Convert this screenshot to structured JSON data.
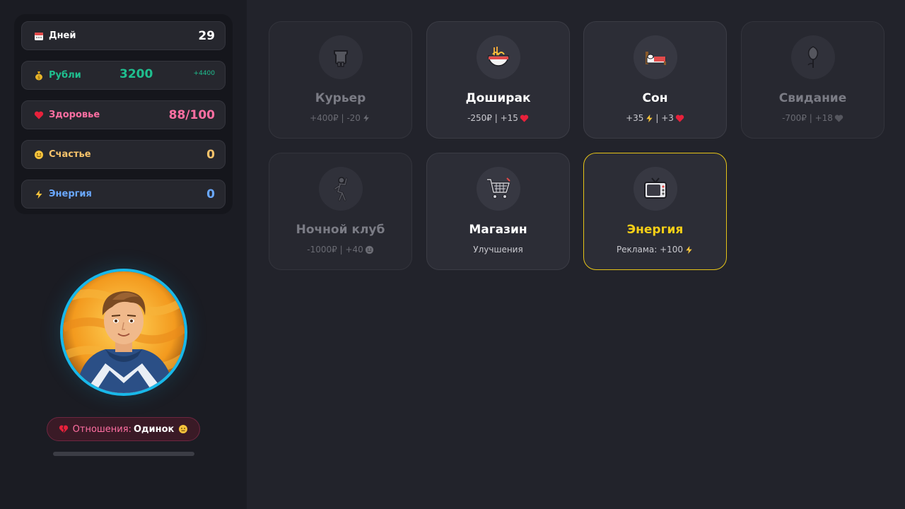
{
  "stats": {
    "days": {
      "label": "Дней",
      "value": "29",
      "color": "#ffffff",
      "icon": "calendar-icon"
    },
    "money": {
      "label": "Рубли",
      "value": "3200",
      "delta": "+4400",
      "color": "#1fbf8f",
      "icon": "money-bag-icon"
    },
    "health": {
      "label": "Здоровье",
      "value": "88/100",
      "color": "#ff6fa2",
      "icon": "heart-icon"
    },
    "happiness": {
      "label": "Счастье",
      "value": "0",
      "color": "#f7c36b",
      "icon": "smile-icon"
    },
    "energy": {
      "label": "Энергия",
      "value": "0",
      "color": "#6aa8ff",
      "icon": "lightning-icon"
    }
  },
  "relationship": {
    "label": "Отношения:",
    "value": "Одинок",
    "progress": 0
  },
  "actions": [
    {
      "title": "Курьер",
      "sub": "+400₽ | -20",
      "sub_icon": "lightning-icon",
      "icon": "courier-icon",
      "state": "disabled"
    },
    {
      "title": "Доширак",
      "sub": "-250₽ | +15",
      "sub_icon": "heart-icon",
      "icon": "noodles-icon",
      "state": "enabled"
    },
    {
      "title": "Сон",
      "sub_a": "+35",
      "sub_b": "| +3",
      "icon": "bed-icon",
      "state": "enabled"
    },
    {
      "title": "Свидание",
      "sub": "-700₽ | +18",
      "sub_icon": "heart-icon",
      "icon": "rose-icon",
      "state": "disabled"
    },
    {
      "title": "Ночной клуб",
      "sub": "-1000₽ | +40",
      "sub_icon": "smile-icon",
      "icon": "dancer-icon",
      "state": "disabled"
    },
    {
      "title": "Магазин",
      "sub": "Улучшения",
      "icon": "cart-icon",
      "state": "enabled"
    },
    {
      "title": "Энергия",
      "sub": "Реклама: +100",
      "sub_icon": "lightning-icon",
      "icon": "tv-icon",
      "state": "selected"
    }
  ],
  "colors": {
    "accent_selected": "#e6c418",
    "avatar_ring": "#18b8ea",
    "money": "#1fbf8f",
    "health": "#ff6fa2"
  }
}
